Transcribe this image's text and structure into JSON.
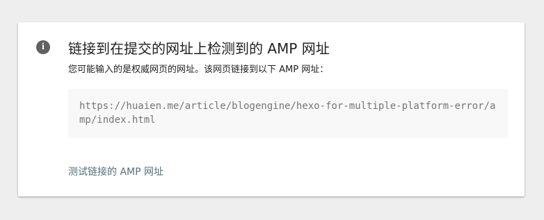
{
  "card": {
    "icon": "info-icon",
    "icon_glyph": "i",
    "title": "链接到在提交的网址上检测到的 AMP 网址",
    "subtitle": "您可能输入的是权威网页的网址。该网页链接到以下 AMP 网址：",
    "amp_url": "https://huaien.me/article/blogengine/hexo-for-multiple-platform-error/amp/index.html",
    "test_link_label": "测试链接的 AMP 网址"
  },
  "colors": {
    "background": "#eeeeee",
    "card": "#ffffff",
    "icon": "#616161",
    "url_box": "#f8f8f8",
    "url_text": "#757575",
    "link": "#546e7a"
  }
}
